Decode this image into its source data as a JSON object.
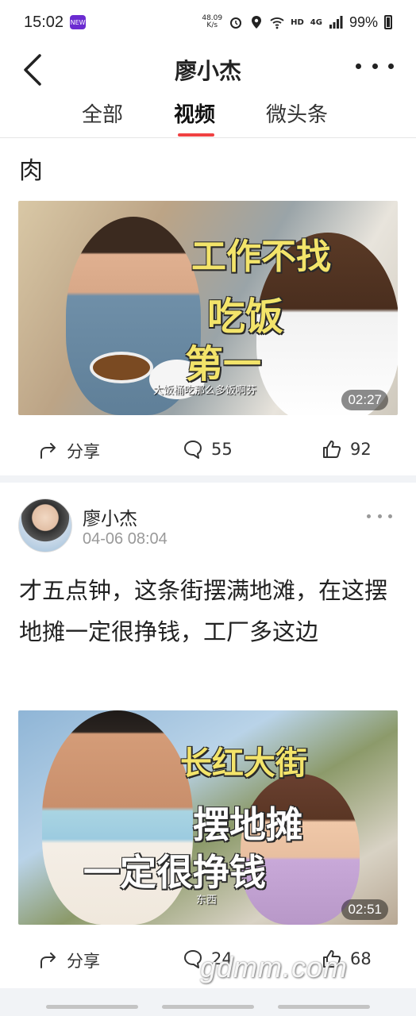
{
  "status_bar": {
    "time": "15:02",
    "app_badge": "NEW",
    "net_speed_value": "48.09",
    "net_speed_unit": "K/s",
    "network": "HD",
    "signal": "4G",
    "battery": "99%"
  },
  "nav": {
    "title": "廖小杰"
  },
  "tabs": [
    {
      "label": "全部"
    },
    {
      "label": "视频"
    },
    {
      "label": "微头条"
    }
  ],
  "post1": {
    "text": "肉",
    "video": {
      "caption_line1": "工作不找",
      "caption_line2": "吃饭",
      "caption_line3": "第一",
      "subtitle": "大饭桶吃那么多饭啊芬",
      "duration": "02:27"
    },
    "actions": {
      "share": "分享",
      "comments": "55",
      "likes": "92"
    }
  },
  "post2": {
    "author": "廖小杰",
    "time": "04-06 08:04",
    "text": "才五点钟，这条街摆满地滩，在这摆地摊一定很挣钱，工厂多这边",
    "video": {
      "caption_line1": "长红大街",
      "caption_line2": "摆地摊",
      "caption_line3": "一定很挣钱",
      "subtitle": "东西",
      "duration": "02:51"
    },
    "actions": {
      "share": "分享",
      "comments": "24",
      "likes": "68"
    }
  },
  "watermark": "gdmm.com",
  "colors": {
    "accent": "#f04142",
    "divider": "#f1f3f6",
    "caption_yellow": "#f3e46a"
  }
}
